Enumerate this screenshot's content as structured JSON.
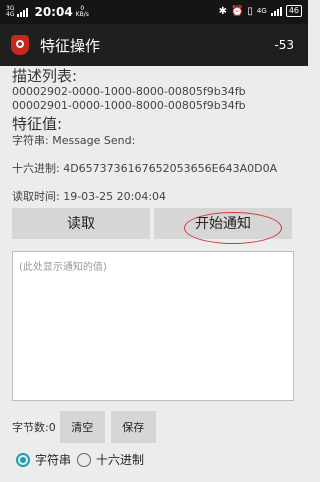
{
  "status_bar": {
    "network_top": "3G",
    "network_bottom": "4G",
    "time": "20:04",
    "speed_value": "0",
    "speed_unit": "KB/s",
    "icons": [
      "bluetooth-icon",
      "alarm-icon",
      "vibrate-icon",
      "signal-icon",
      "battery-icon"
    ],
    "signal_4g": "4G",
    "battery": "46"
  },
  "app_bar": {
    "title": "特征操作",
    "rssi": "-53",
    "accent_color": "#c8271e"
  },
  "descriptors": {
    "title": "描述列表:",
    "items": [
      "00002902-0000-1000-8000-00805f9b34fb",
      "00002901-0000-1000-8000-00805f9b34fb"
    ]
  },
  "characteristic": {
    "title": "特征值:",
    "string_label": "字符串: Message Send:",
    "hex_label": "十六进制: 4D6573736167652053656E643A0D0A",
    "read_time_label": "读取时间: 19-03-25 20:04:04"
  },
  "actions": {
    "read_label": "读取",
    "notify_label": "开始通知"
  },
  "notify_area": {
    "placeholder": "(此处显示通知的值)"
  },
  "bottom": {
    "byte_count_label": "字节数:0",
    "clear_label": "清空",
    "save_label": "保存"
  },
  "format": {
    "string_option": "字符串",
    "hex_option": "十六进制",
    "selected": "string",
    "radio_color": "#1e9fb0"
  }
}
